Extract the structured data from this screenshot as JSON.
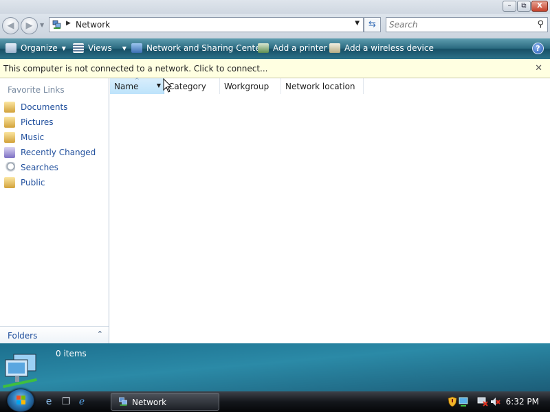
{
  "window": {
    "buttons": {
      "minimize": "–",
      "maximize": "⧉",
      "close": "X"
    }
  },
  "address_bar": {
    "breadcrumb": "Network",
    "search_placeholder": "Search"
  },
  "command_bar": {
    "organize": "Organize",
    "views": "Views",
    "network_sharing": "Network and Sharing Center",
    "add_printer": "Add a printer",
    "add_wireless": "Add a wireless device",
    "help": "?"
  },
  "info_bar": {
    "message": "This computer is not connected to a network. Click to connect...",
    "close": "✕"
  },
  "left_nav": {
    "header": "Favorite Links",
    "items": [
      {
        "label": "Documents",
        "icon": "documents-icon"
      },
      {
        "label": "Pictures",
        "icon": "pictures-icon"
      },
      {
        "label": "Music",
        "icon": "music-icon"
      },
      {
        "label": "Recently Changed",
        "icon": "recently-changed-icon"
      },
      {
        "label": "Searches",
        "icon": "searches-icon"
      },
      {
        "label": "Public",
        "icon": "public-icon"
      }
    ],
    "folders_label": "Folders"
  },
  "columns": [
    "Name",
    "Category",
    "Workgroup",
    "Network location"
  ],
  "details": {
    "item_count": "0 items"
  },
  "taskbar": {
    "task_label": "Network",
    "clock": "6:32 PM"
  },
  "colors": {
    "command_bar": "#2b6a80",
    "info_bar": "#ffffe1",
    "link": "#1f4e9c",
    "details_pane": "#2b8aa7"
  }
}
